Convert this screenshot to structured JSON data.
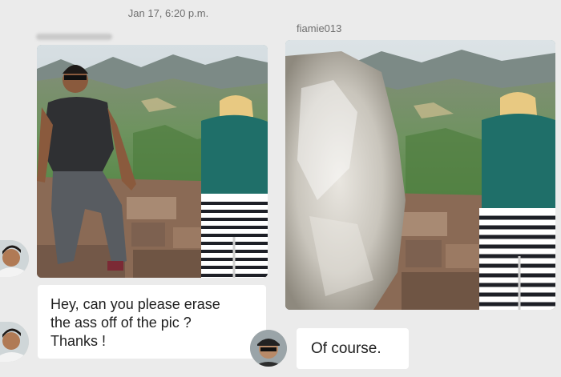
{
  "header": {
    "timestamp": "Jan 17, 6:20 p.m."
  },
  "other_user": {
    "username": "fiamie013"
  },
  "messages": [
    {
      "sender": "user",
      "type": "photo",
      "description_icon": "image-icon"
    },
    {
      "sender": "user",
      "type": "text",
      "text": "Hey, can you please erase\nthe ass off of the pic ?\nThanks !"
    },
    {
      "sender": "other",
      "type": "photo",
      "description_icon": "image-icon"
    },
    {
      "sender": "other",
      "type": "text",
      "text": "Of course."
    }
  ],
  "colors": {
    "background": "#ebebeb",
    "bubble": "#ffffff",
    "meta_text": "#6f6f6f"
  }
}
